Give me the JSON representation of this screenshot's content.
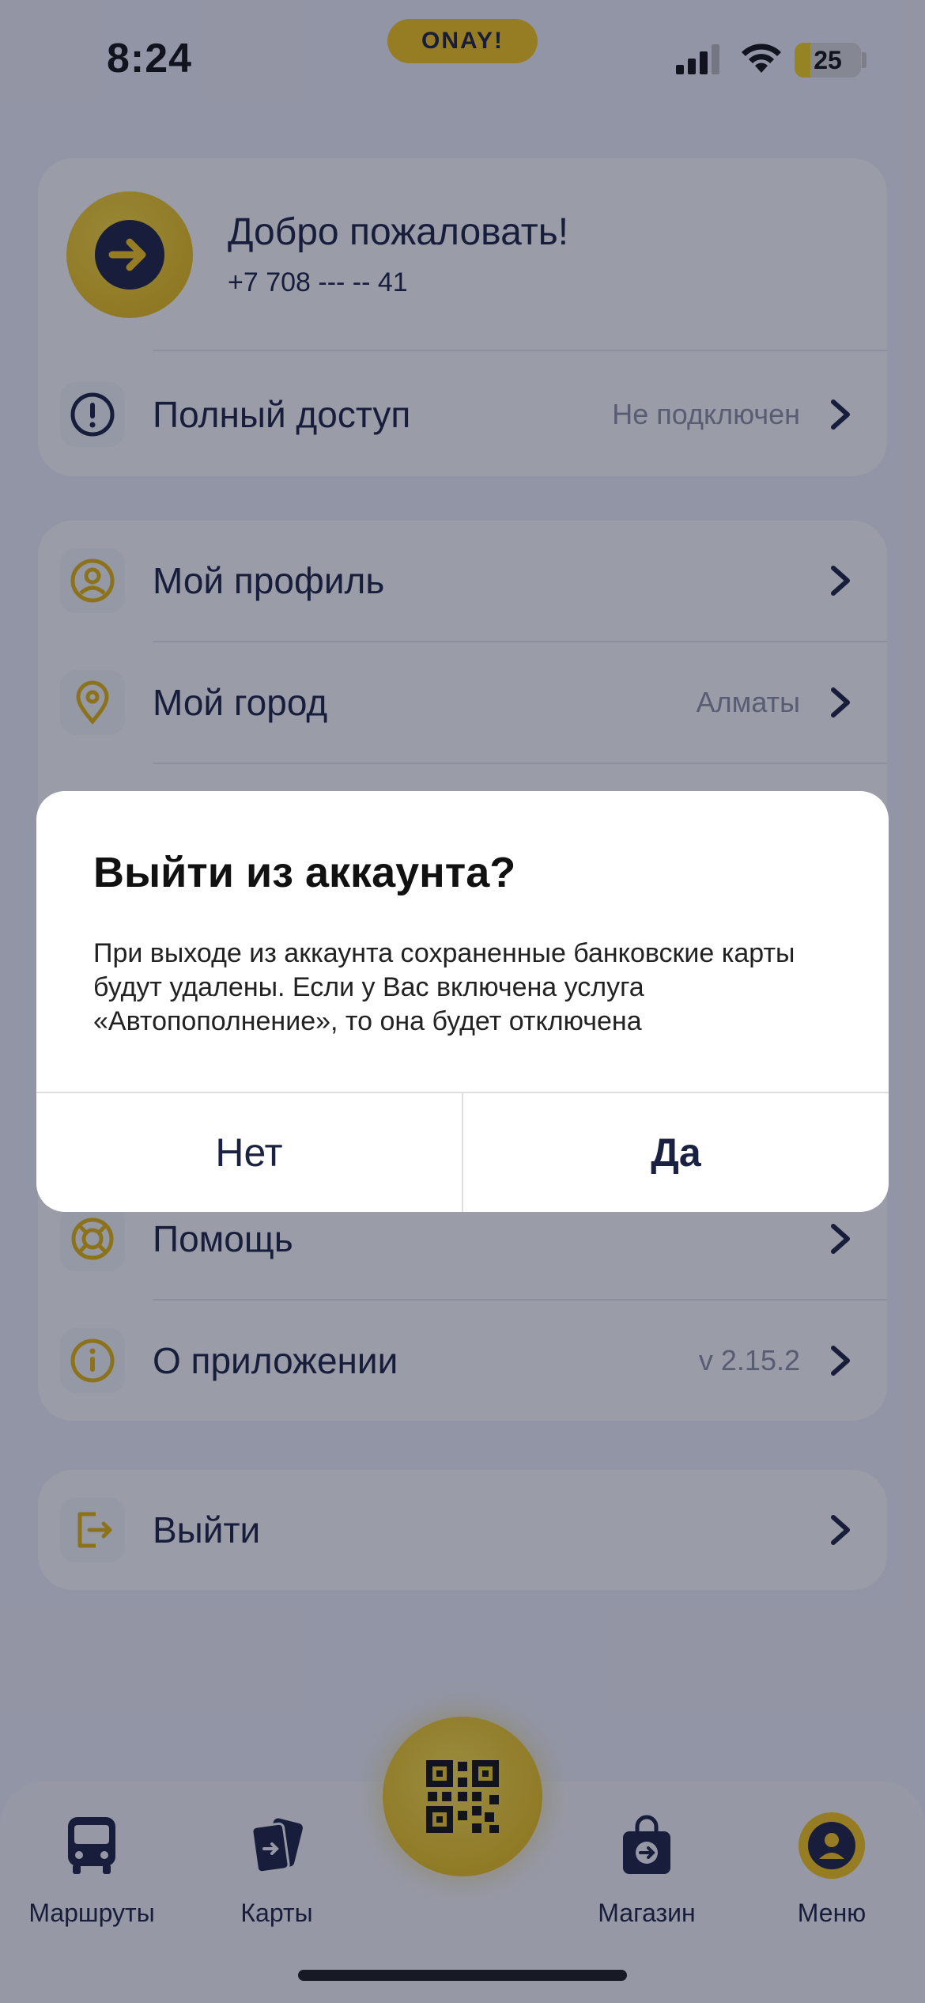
{
  "status": {
    "time": "8:24",
    "battery": "25"
  },
  "brand": {
    "name": "ONAY!"
  },
  "account": {
    "welcome_title": "Добро пожаловать!",
    "phone": "+7 708 --- -- 41",
    "full_access_label": "Полный доступ",
    "full_access_value": "Не подключен"
  },
  "menu": {
    "items": [
      {
        "label": "Мой профиль",
        "value": "",
        "icon": "user-icon"
      },
      {
        "label": "Мой город",
        "value": "Алматы",
        "icon": "location-pin-icon"
      },
      {
        "label": "Помощь",
        "value": "",
        "icon": "lifebuoy-icon"
      },
      {
        "label": "О приложении",
        "value": "v 2.15.2",
        "icon": "info-icon"
      }
    ],
    "logout": "Выйти"
  },
  "dialog": {
    "title": "Выйти из аккаунта?",
    "message": "При выходе из аккаунта сохраненные банковские карты будут удалены. Если у Вас включена услуга «Автопополнение», то она будет отключена",
    "no": "Нет",
    "yes": "Да"
  },
  "tabbar": {
    "items": [
      {
        "label": "Маршруты",
        "icon": "bus-icon"
      },
      {
        "label": "Карты",
        "icon": "cards-icon"
      },
      {
        "label": "Магазин",
        "icon": "shop-bag-icon"
      },
      {
        "label": "Меню",
        "icon": "user-circle-icon"
      }
    ]
  },
  "colors": {
    "accent": "#f5c518",
    "text": "#1b2140",
    "overlay": "#141832"
  }
}
